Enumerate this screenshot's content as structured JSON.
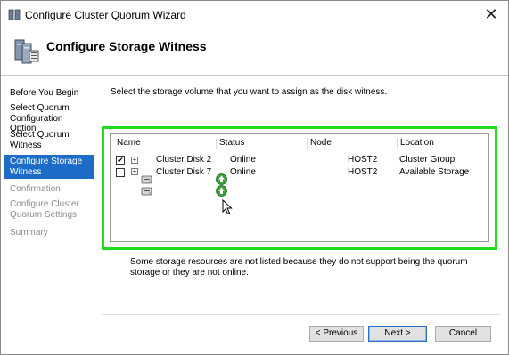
{
  "window": {
    "title": "Configure Cluster Quorum Wizard",
    "header_title": "Configure Storage Witness"
  },
  "sidebar": {
    "items": [
      {
        "label": "Before You Begin",
        "state": "normal"
      },
      {
        "label": "Select Quorum Configuration Option",
        "state": "normal"
      },
      {
        "label": "Select Quorum Witness",
        "state": "normal"
      },
      {
        "label": "Configure Storage Witness",
        "state": "active"
      },
      {
        "label": "Confirmation",
        "state": "disabled"
      },
      {
        "label": "Configure Cluster Quorum Settings",
        "state": "disabled"
      },
      {
        "label": "Summary",
        "state": "disabled"
      }
    ]
  },
  "main": {
    "instruction": "Select the storage volume that you want to assign as the disk witness.",
    "table": {
      "columns": [
        "Name",
        "Status",
        "Node",
        "Location"
      ],
      "rows": [
        {
          "name": "Cluster Disk 2",
          "status": "Online",
          "node": "HOST2",
          "location": "Cluster Group",
          "checked": true,
          "check_glyph": "✔"
        },
        {
          "name": "Cluster Disk 7",
          "status": "Online",
          "node": "HOST2",
          "location": "Available Storage",
          "checked": false,
          "check_glyph": ""
        }
      ]
    },
    "note": "Some storage resources are not listed because they do not support being the quorum storage or they are not online."
  },
  "buttons": {
    "previous": "< Previous",
    "next": "Next >",
    "cancel": "Cancel"
  },
  "icons": {
    "close": "✕",
    "expand": "+"
  },
  "colors": {
    "active_step": "#1d6cc8",
    "highlight": "#22dc22",
    "disabled_text": "#8c8c8c"
  }
}
